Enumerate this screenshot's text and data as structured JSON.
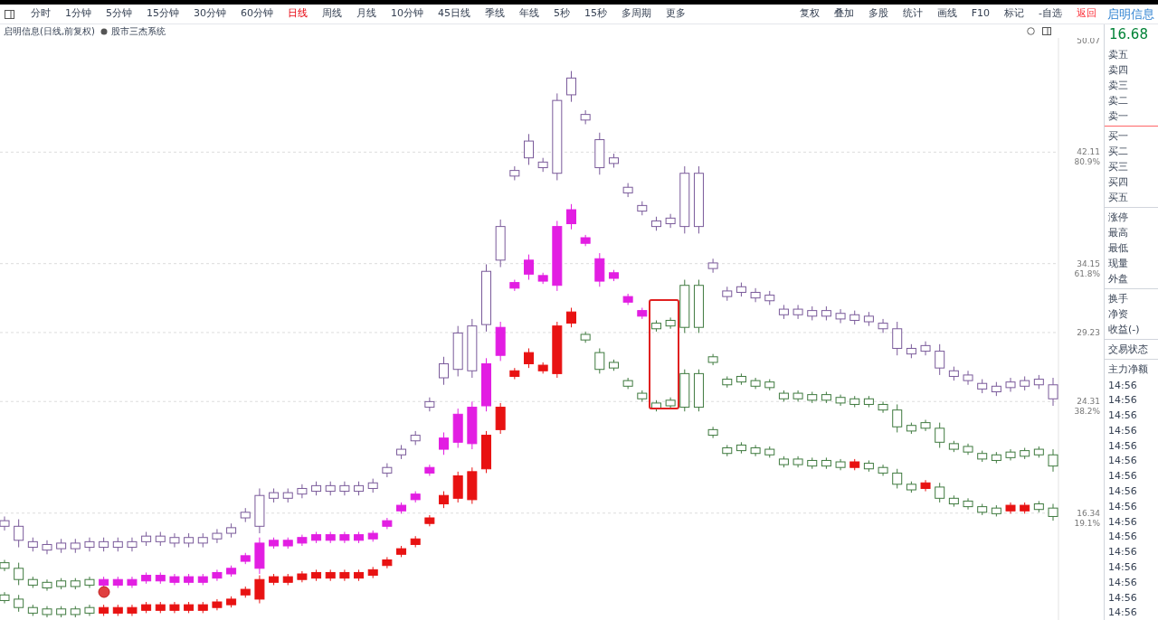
{
  "toolbar": {
    "period_tabs": [
      {
        "label": "分时",
        "selected": false
      },
      {
        "label": "1分钟",
        "selected": false
      },
      {
        "label": "5分钟",
        "selected": false
      },
      {
        "label": "15分钟",
        "selected": false
      },
      {
        "label": "30分钟",
        "selected": false
      },
      {
        "label": "60分钟",
        "selected": false
      },
      {
        "label": "日线",
        "selected": true
      },
      {
        "label": "周线",
        "selected": false
      },
      {
        "label": "月线",
        "selected": false
      },
      {
        "label": "10分钟",
        "selected": false
      },
      {
        "label": "45日线",
        "selected": false
      },
      {
        "label": "季线",
        "selected": false
      },
      {
        "label": "年线",
        "selected": false
      },
      {
        "label": "5秒",
        "selected": false
      },
      {
        "label": "15秒",
        "selected": false
      },
      {
        "label": "多周期",
        "selected": false
      },
      {
        "label": "更多",
        "selected": false
      }
    ],
    "tools": [
      {
        "label": "复权",
        "kind": "plain"
      },
      {
        "label": "叠加",
        "kind": "plain"
      },
      {
        "label": "多股",
        "kind": "plain"
      },
      {
        "label": "统计",
        "kind": "plain"
      },
      {
        "label": "画线",
        "kind": "plain"
      },
      {
        "label": "F10",
        "kind": "plain"
      },
      {
        "label": "标记",
        "kind": "plain"
      },
      {
        "label": "-自选",
        "kind": "plain"
      },
      {
        "label": "返回",
        "kind": "exit"
      }
    ],
    "stock_name": "启明信息"
  },
  "chart": {
    "title": "启明信息(日线,前复权)",
    "indicator": "股市三杰系统",
    "price_axis": [
      {
        "price": "50.07"
      },
      {
        "price": "42.11",
        "percent": "80.9%"
      },
      {
        "price": "34.15",
        "percent": "61.8%"
      },
      {
        "price": "29.23"
      },
      {
        "price": "24.31",
        "percent": "38.2%"
      },
      {
        "price": "16.34",
        "percent": "19.1%"
      }
    ],
    "chart_data": {
      "type": "candlestick",
      "grid": true,
      "ylim": [
        8.71,
        50.26
      ],
      "yticks": [
        50.07,
        42.11,
        34.15,
        29.23,
        24.31,
        16.34
      ],
      "series": [
        {
          "color": "#7a5a9a",
          "ohlc": [
            [
              15.8,
              16.1,
              15.1,
              15.4
            ],
            [
              15.4,
              15.9,
              13.9,
              14.4
            ],
            [
              14.3,
              14.6,
              13.6,
              13.9
            ],
            [
              14.1,
              14.4,
              13.4,
              13.7
            ],
            [
              14.2,
              14.5,
              13.5,
              13.8
            ],
            [
              14.2,
              14.5,
              13.5,
              13.8
            ],
            [
              14.3,
              14.6,
              13.6,
              13.9
            ],
            [
              14.3,
              14.6,
              13.6,
              13.9
            ],
            [
              14.3,
              14.6,
              13.6,
              13.9
            ],
            [
              14.3,
              14.6,
              13.6,
              13.9
            ],
            [
              14.7,
              15.0,
              14.0,
              14.3
            ],
            [
              14.7,
              15.0,
              14.0,
              14.3
            ],
            [
              14.6,
              14.9,
              13.9,
              14.2
            ],
            [
              14.6,
              14.9,
              13.9,
              14.2
            ],
            [
              14.6,
              14.9,
              13.9,
              14.2
            ],
            [
              14.9,
              15.2,
              14.2,
              14.5
            ],
            [
              15.3,
              15.6,
              14.6,
              14.9
            ],
            [
              16.4,
              16.7,
              15.7,
              16.0
            ],
            [
              17.6,
              18.1,
              14.9,
              15.4
            ],
            [
              17.8,
              18.1,
              17.1,
              17.4
            ],
            [
              17.8,
              18.1,
              17.1,
              17.4
            ],
            [
              18.1,
              18.4,
              17.4,
              17.7
            ],
            [
              18.3,
              18.6,
              17.6,
              17.9
            ],
            [
              18.3,
              18.6,
              17.6,
              17.9
            ],
            [
              18.3,
              18.6,
              17.6,
              17.9
            ],
            [
              18.3,
              18.6,
              17.6,
              17.9
            ],
            [
              18.5,
              18.8,
              17.8,
              18.1
            ],
            [
              19.6,
              19.9,
              18.9,
              19.2
            ],
            [
              20.9,
              21.2,
              20.2,
              20.5
            ],
            [
              21.9,
              22.2,
              21.2,
              21.5
            ],
            [
              24.3,
              24.6,
              23.6,
              23.9
            ],
            [
              27.0,
              27.5,
              25.5,
              26.0
            ],
            [
              29.2,
              29.7,
              26.1,
              26.6
            ],
            [
              29.7,
              30.2,
              26.0,
              26.5
            ],
            [
              33.6,
              34.1,
              29.3,
              29.8
            ],
            [
              36.8,
              37.3,
              33.9,
              34.4
            ],
            [
              40.8,
              41.1,
              40.1,
              40.4
            ],
            [
              42.9,
              43.4,
              41.2,
              41.7
            ],
            [
              41.4,
              41.7,
              40.7,
              41.0
            ],
            [
              45.8,
              46.3,
              40.1,
              40.6
            ],
            [
              47.4,
              47.9,
              45.7,
              46.2
            ],
            [
              44.8,
              45.1,
              44.1,
              44.4
            ],
            [
              43.0,
              43.5,
              40.5,
              41.0
            ],
            [
              41.7,
              42.0,
              41.0,
              41.3
            ],
            [
              39.6,
              39.9,
              38.9,
              39.2
            ],
            [
              38.3,
              38.6,
              37.6,
              37.9
            ],
            [
              37.2,
              37.5,
              36.5,
              36.8
            ],
            [
              37.4,
              37.7,
              36.7,
              37.0
            ],
            [
              40.6,
              41.1,
              36.3,
              36.8
            ],
            [
              40.6,
              41.1,
              36.3,
              36.8
            ],
            [
              34.2,
              34.5,
              33.5,
              33.8
            ],
            [
              32.2,
              32.5,
              31.5,
              31.8
            ],
            [
              32.5,
              32.8,
              31.8,
              32.1
            ],
            [
              32.1,
              32.4,
              31.4,
              31.7
            ],
            [
              31.9,
              32.2,
              31.2,
              31.5
            ],
            [
              30.9,
              31.2,
              30.2,
              30.5
            ],
            [
              30.9,
              31.2,
              30.2,
              30.5
            ],
            [
              30.8,
              31.1,
              30.1,
              30.4
            ],
            [
              30.8,
              31.1,
              30.1,
              30.4
            ],
            [
              30.6,
              30.9,
              29.9,
              30.2
            ],
            [
              30.5,
              30.8,
              29.8,
              30.1
            ],
            [
              30.4,
              30.7,
              29.7,
              30.0
            ],
            [
              29.9,
              30.2,
              29.2,
              29.5
            ],
            [
              29.5,
              30.0,
              27.6,
              28.1
            ],
            [
              28.1,
              28.4,
              27.4,
              27.7
            ],
            [
              28.3,
              28.6,
              27.6,
              27.9
            ],
            [
              27.9,
              28.4,
              26.2,
              26.7
            ],
            [
              26.5,
              26.8,
              25.8,
              26.1
            ],
            [
              26.2,
              26.5,
              25.5,
              25.8
            ],
            [
              25.6,
              25.9,
              24.9,
              25.2
            ],
            [
              25.4,
              25.7,
              24.7,
              25.0
            ],
            [
              25.7,
              26.0,
              25.0,
              25.3
            ],
            [
              25.8,
              26.1,
              25.1,
              25.4
            ],
            [
              25.9,
              26.2,
              25.2,
              25.5
            ],
            [
              25.5,
              26.0,
              24.0,
              24.5
            ]
          ]
        },
        {
          "color": "#3f7a3f",
          "ohlc": [
            [
              12.8,
              13.0,
              12.2,
              12.4
            ],
            [
              12.4,
              12.8,
              11.2,
              11.6
            ],
            [
              11.6,
              11.8,
              11.0,
              11.2
            ],
            [
              11.4,
              11.6,
              10.8,
              11.0
            ],
            [
              11.5,
              11.7,
              10.9,
              11.1
            ],
            [
              11.5,
              11.7,
              10.9,
              11.1
            ],
            [
              11.6,
              11.8,
              11.0,
              11.2
            ],
            null,
            null,
            null,
            null,
            null,
            null,
            null,
            null,
            null,
            null,
            null,
            null,
            null,
            null,
            null,
            null,
            null,
            null,
            null,
            null,
            null,
            null,
            null,
            null,
            null,
            null,
            null,
            null,
            null,
            null,
            null,
            null,
            null,
            null,
            null,
            null,
            null,
            null,
            null,
            [
              29.9,
              30.1,
              29.3,
              29.5
            ],
            [
              30.1,
              30.3,
              29.5,
              29.7
            ],
            [
              32.6,
              33.0,
              29.2,
              29.6
            ],
            [
              32.6,
              33.0,
              29.2,
              29.6
            ],
            [
              27.5,
              27.7,
              26.9,
              27.1
            ],
            [
              25.9,
              26.1,
              25.3,
              25.5
            ],
            [
              26.1,
              26.3,
              25.5,
              25.7
            ],
            [
              25.8,
              26.0,
              25.2,
              25.4
            ],
            [
              25.7,
              25.9,
              25.1,
              25.3
            ],
            [
              24.9,
              25.1,
              24.3,
              24.5
            ],
            [
              24.9,
              25.1,
              24.3,
              24.5
            ],
            [
              24.8,
              25.0,
              24.2,
              24.4
            ],
            [
              24.8,
              25.0,
              24.2,
              24.4
            ],
            [
              24.6,
              24.8,
              24.0,
              24.2
            ],
            [
              24.5,
              24.7,
              23.9,
              24.1
            ],
            [
              24.5,
              24.7,
              23.9,
              24.1
            ],
            [
              24.1,
              24.3,
              23.5,
              23.7
            ],
            [
              23.7,
              24.1,
              22.1,
              22.5
            ],
            [
              22.6,
              22.8,
              22.0,
              22.2
            ],
            [
              22.8,
              23.0,
              22.2,
              22.4
            ],
            [
              22.4,
              22.8,
              21.0,
              21.4
            ],
            [
              21.3,
              21.5,
              20.7,
              20.9
            ],
            [
              21.1,
              21.3,
              20.5,
              20.7
            ],
            [
              20.6,
              20.8,
              20.0,
              20.2
            ],
            [
              20.5,
              20.7,
              19.9,
              20.1
            ],
            [
              20.7,
              20.9,
              20.1,
              20.3
            ],
            [
              20.8,
              21.0,
              20.2,
              20.4
            ],
            [
              20.9,
              21.1,
              20.3,
              20.5
            ],
            [
              20.5,
              20.9,
              19.3,
              19.7
            ]
          ]
        },
        {
          "color": "#e21ee2",
          "ohlc": [
            null,
            null,
            null,
            null,
            null,
            null,
            null,
            [
              11.2,
              11.8,
              11.0,
              11.6
            ],
            [
              11.2,
              11.8,
              11.0,
              11.6
            ],
            [
              11.2,
              11.8,
              11.0,
              11.6
            ],
            [
              11.5,
              12.1,
              11.3,
              11.9
            ],
            [
              11.5,
              12.1,
              11.3,
              11.9
            ],
            [
              11.4,
              12.0,
              11.2,
              11.8
            ],
            [
              11.4,
              12.0,
              11.2,
              11.8
            ],
            [
              11.4,
              12.0,
              11.2,
              11.8
            ],
            [
              11.7,
              12.3,
              11.5,
              12.1
            ],
            [
              12.0,
              12.6,
              11.8,
              12.4
            ],
            [
              12.9,
              13.5,
              12.7,
              13.3
            ],
            [
              12.4,
              14.6,
              12.0,
              14.2
            ],
            [
              14.0,
              14.6,
              13.8,
              14.4
            ],
            [
              14.0,
              14.6,
              13.8,
              14.4
            ],
            [
              14.2,
              14.8,
              14.0,
              14.6
            ],
            [
              14.4,
              15.0,
              14.2,
              14.8
            ],
            [
              14.4,
              15.0,
              14.2,
              14.8
            ],
            [
              14.4,
              15.0,
              14.2,
              14.8
            ],
            [
              14.4,
              15.0,
              14.2,
              14.8
            ],
            [
              14.5,
              15.1,
              14.3,
              14.9
            ],
            [
              15.4,
              16.0,
              15.2,
              15.8
            ],
            [
              16.5,
              17.1,
              16.3,
              16.9
            ],
            [
              17.3,
              17.9,
              17.1,
              17.7
            ],
            [
              19.2,
              19.8,
              19.0,
              19.6
            ],
            [
              20.9,
              22.1,
              20.5,
              21.7
            ],
            [
              21.4,
              23.8,
              21.0,
              23.4
            ],
            [
              21.3,
              24.3,
              20.9,
              23.9
            ],
            [
              24.0,
              27.4,
              23.6,
              27.0
            ],
            [
              27.6,
              30.0,
              27.2,
              29.6
            ],
            [
              32.4,
              33.0,
              32.2,
              32.8
            ],
            [
              33.4,
              34.8,
              33.0,
              34.4
            ],
            [
              32.9,
              33.5,
              32.7,
              33.3
            ],
            [
              32.6,
              37.2,
              32.2,
              36.8
            ],
            [
              37.0,
              38.4,
              36.6,
              38.0
            ],
            [
              35.6,
              36.2,
              35.4,
              36.0
            ],
            [
              32.9,
              34.9,
              32.5,
              34.5
            ],
            [
              33.1,
              33.7,
              32.9,
              33.5
            ],
            [
              31.4,
              32.0,
              31.2,
              31.8
            ],
            [
              30.4,
              31.0,
              30.2,
              30.8
            ],
            null,
            null,
            null,
            null,
            null,
            null,
            null,
            null,
            null,
            null,
            null,
            null,
            null,
            null,
            null,
            null,
            null,
            null,
            null,
            null,
            null,
            null,
            null,
            null,
            null,
            null,
            null,
            null,
            null
          ]
        },
        {
          "color": "#3f7a3f",
          "ohlc": [
            [
              10.5,
              10.7,
              9.9,
              10.1
            ],
            [
              10.2,
              10.5,
              9.3,
              9.6
            ],
            [
              9.6,
              9.8,
              9.0,
              9.2
            ],
            [
              9.5,
              9.7,
              8.9,
              9.1
            ],
            [
              9.5,
              9.7,
              8.9,
              9.1
            ],
            [
              9.5,
              9.7,
              8.9,
              9.1
            ],
            [
              9.6,
              9.8,
              9.0,
              9.2
            ],
            null,
            null,
            null,
            null,
            null,
            null,
            null,
            null,
            null,
            null,
            null,
            null,
            null,
            null,
            null,
            null,
            null,
            null,
            null,
            null,
            null,
            null,
            null,
            null,
            null,
            null,
            null,
            null,
            null,
            null,
            null,
            null,
            null,
            null,
            [
              29.1,
              29.3,
              28.5,
              28.7
            ],
            [
              27.8,
              28.1,
              26.3,
              26.6
            ],
            [
              27.1,
              27.3,
              26.5,
              26.7
            ],
            [
              25.8,
              26.0,
              25.2,
              25.4
            ],
            [
              24.9,
              25.1,
              24.3,
              24.5
            ],
            [
              24.2,
              24.4,
              23.6,
              23.8
            ],
            [
              24.4,
              24.6,
              23.8,
              24.0
            ],
            [
              26.3,
              26.6,
              23.6,
              23.9
            ],
            [
              26.3,
              26.6,
              23.6,
              23.9
            ],
            [
              22.3,
              22.5,
              21.7,
              21.9
            ],
            [
              21.0,
              21.2,
              20.4,
              20.6
            ],
            [
              21.2,
              21.4,
              20.6,
              20.8
            ],
            [
              21.0,
              21.2,
              20.4,
              20.6
            ],
            [
              20.9,
              21.1,
              20.3,
              20.5
            ],
            [
              20.2,
              20.4,
              19.6,
              19.8
            ],
            [
              20.2,
              20.4,
              19.6,
              19.8
            ],
            [
              20.1,
              20.3,
              19.5,
              19.7
            ],
            [
              20.1,
              20.3,
              19.5,
              19.7
            ],
            [
              20.0,
              20.2,
              19.4,
              19.6
            ],
            null,
            [
              19.9,
              20.1,
              19.3,
              19.5
            ],
            [
              19.6,
              19.8,
              19.0,
              19.2
            ],
            [
              19.2,
              19.5,
              18.1,
              18.4
            ],
            [
              18.4,
              18.6,
              17.8,
              18.0
            ],
            null,
            [
              18.2,
              18.5,
              17.1,
              17.4
            ],
            [
              17.4,
              17.6,
              16.8,
              17.0
            ],
            [
              17.2,
              17.4,
              16.6,
              16.8
            ],
            [
              16.8,
              17.0,
              16.2,
              16.4
            ],
            [
              16.7,
              16.9,
              16.1,
              16.3
            ],
            null,
            null,
            [
              17.0,
              17.2,
              16.4,
              16.6
            ],
            [
              16.7,
              17.0,
              15.8,
              16.1
            ]
          ]
        },
        {
          "color": "#e81212",
          "ohlc": [
            null,
            null,
            null,
            null,
            null,
            null,
            null,
            [
              9.2,
              9.8,
              9.0,
              9.6
            ],
            [
              9.2,
              9.8,
              9.0,
              9.6
            ],
            [
              9.2,
              9.8,
              9.0,
              9.6
            ],
            [
              9.4,
              10.0,
              9.2,
              9.8
            ],
            [
              9.4,
              10.0,
              9.2,
              9.8
            ],
            [
              9.4,
              10.0,
              9.2,
              9.8
            ],
            [
              9.4,
              10.0,
              9.2,
              9.8
            ],
            [
              9.4,
              10.0,
              9.2,
              9.8
            ],
            [
              9.6,
              10.2,
              9.4,
              10.0
            ],
            [
              9.8,
              10.4,
              9.6,
              10.2
            ],
            [
              10.5,
              11.1,
              10.3,
              10.9
            ],
            [
              10.2,
              11.9,
              9.9,
              11.6
            ],
            [
              11.4,
              12.0,
              11.2,
              11.8
            ],
            [
              11.4,
              12.0,
              11.2,
              11.8
            ],
            [
              11.6,
              12.2,
              11.4,
              12.0
            ],
            [
              11.7,
              12.3,
              11.5,
              12.1
            ],
            [
              11.7,
              12.3,
              11.5,
              12.1
            ],
            [
              11.7,
              12.3,
              11.5,
              12.1
            ],
            [
              11.7,
              12.3,
              11.5,
              12.1
            ],
            [
              11.9,
              12.5,
              11.7,
              12.3
            ],
            [
              12.6,
              13.2,
              12.4,
              13.0
            ],
            [
              13.4,
              14.0,
              13.2,
              13.8
            ],
            [
              14.1,
              14.7,
              13.9,
              14.5
            ],
            [
              15.6,
              16.2,
              15.4,
              16.0
            ],
            [
              17.0,
              17.9,
              16.7,
              17.6
            ],
            [
              17.4,
              19.3,
              17.1,
              19.0
            ],
            [
              17.3,
              19.6,
              17.0,
              19.3
            ],
            [
              19.5,
              22.2,
              19.2,
              21.9
            ],
            [
              22.3,
              24.2,
              22.0,
              23.9
            ],
            [
              26.1,
              26.7,
              25.9,
              26.5
            ],
            [
              27.0,
              28.1,
              26.7,
              27.8
            ],
            [
              26.5,
              27.1,
              26.3,
              26.9
            ],
            [
              26.3,
              30.0,
              26.0,
              29.7
            ],
            [
              29.9,
              31.0,
              29.6,
              30.7
            ],
            null,
            null,
            null,
            null,
            null,
            null,
            null,
            null,
            null,
            null,
            null,
            null,
            null,
            null,
            null,
            null,
            null,
            null,
            null,
            [
              19.6,
              20.2,
              19.4,
              20.0
            ],
            null,
            null,
            null,
            null,
            [
              18.1,
              18.7,
              17.9,
              18.5
            ],
            null,
            null,
            null,
            null,
            null,
            [
              16.5,
              17.1,
              16.3,
              16.9
            ],
            [
              16.5,
              17.1,
              16.3,
              16.9
            ],
            null,
            null
          ]
        }
      ]
    }
  },
  "quote_panel": {
    "price": "16.68",
    "groups": [
      {
        "labels": [
          "卖五",
          "卖四",
          "卖三",
          "卖二",
          "卖一"
        ],
        "kind": "ask"
      },
      {
        "labels": [
          "买一",
          "买二",
          "买三",
          "买四",
          "买五"
        ],
        "kind": "bid"
      },
      {
        "labels": [
          "涨停",
          "最高",
          "最低",
          "现量",
          "外盘"
        ],
        "kind": "stats"
      },
      {
        "labels": [
          "换手",
          "净资",
          "收益(-)"
        ],
        "kind": "ratios"
      },
      {
        "labels": [
          "交易状态"
        ],
        "kind": "status"
      },
      {
        "labels": [
          "主力净额"
        ],
        "kind": "flow"
      }
    ],
    "times": [
      "14:56",
      "14:56",
      "14:56",
      "14:56",
      "14:56",
      "14:56",
      "14:56",
      "14:56",
      "14:56",
      "14:56",
      "14:56",
      "14:56",
      "14:56",
      "14:56",
      "14:56",
      "14:56"
    ]
  }
}
